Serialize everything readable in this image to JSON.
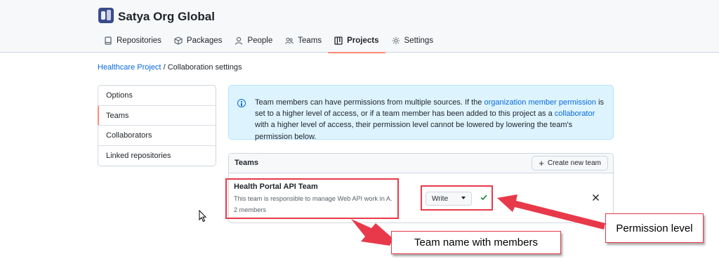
{
  "org": {
    "name": "Satya Org Global"
  },
  "tabs": [
    {
      "label": "Repositories",
      "icon": "repo-icon"
    },
    {
      "label": "Packages",
      "icon": "package-icon"
    },
    {
      "label": "People",
      "icon": "person-icon"
    },
    {
      "label": "Teams",
      "icon": "people-icon"
    },
    {
      "label": "Projects",
      "icon": "table-icon",
      "selected": true
    },
    {
      "label": "Settings",
      "icon": "gear-icon"
    }
  ],
  "breadcrumb": {
    "project": "Healthcare Project",
    "separator": "/",
    "current": "Collaboration settings"
  },
  "side_menu": [
    {
      "label": "Options"
    },
    {
      "label": "Teams",
      "selected": true
    },
    {
      "label": "Collaborators"
    },
    {
      "label": "Linked repositories"
    }
  ],
  "flash": {
    "icon": "info-icon",
    "part1": "Team members can have permissions from multiple sources. If the ",
    "link1": "organization member permission",
    "part2": " is set to a higher level of access, or if a team member has been added to this project as a ",
    "link2": "collaborator",
    "part3": " with a higher level of access, their permission level cannot be lowered by lowering the team's permission below."
  },
  "teams": {
    "title": "Teams",
    "create_label": "Create new team",
    "team": {
      "name": "Health Portal API Team",
      "description": "This team is responsible to manage Web API work in A...",
      "members": "2 members",
      "permission": "Write"
    }
  },
  "annotations": {
    "team_label": "Team name with members",
    "permission_label": "Permission level"
  },
  "colors": {
    "accent_link": "#0969da",
    "tab_underline": "#fd8c73",
    "annotation_red": "#e8394a",
    "flash_bg": "#ddf4ff",
    "check_green": "#1a7f37"
  }
}
